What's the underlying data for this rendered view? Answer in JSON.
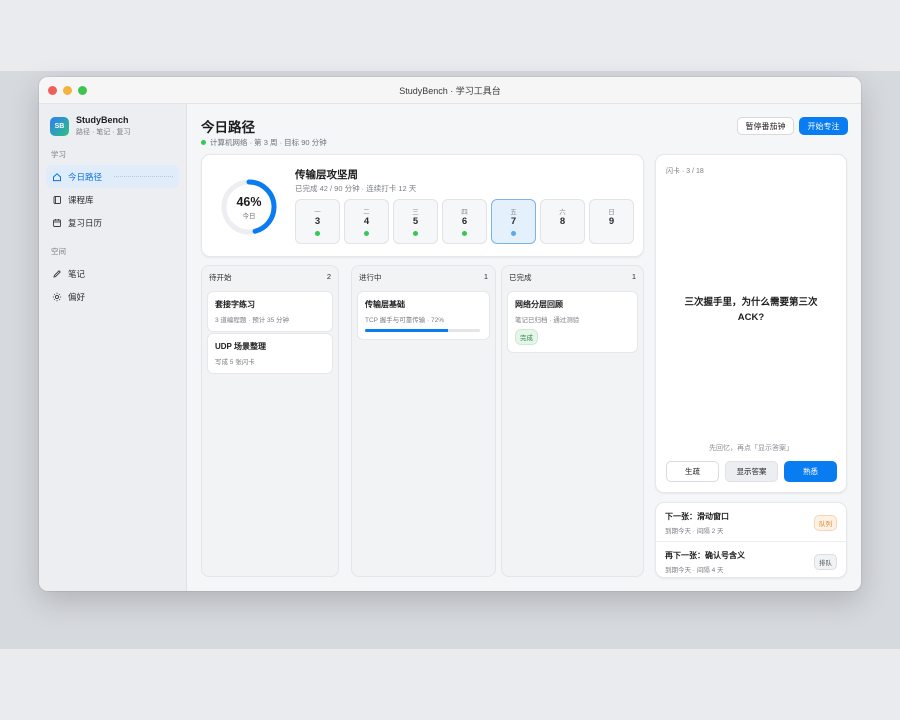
{
  "window": {
    "title": "StudyBench · 学习工具台"
  },
  "sidebar": {
    "brand": {
      "logo": "SB",
      "name": "StudyBench",
      "subtitle": "路径 · 笔记 · 复习"
    },
    "sections": [
      {
        "label": "学习",
        "items": [
          {
            "label": "今日路径",
            "icon": "home-icon",
            "active": true
          },
          {
            "label": "课程库",
            "icon": "book-icon"
          },
          {
            "label": "复习日历",
            "icon": "calendar-icon"
          }
        ]
      },
      {
        "label": "空间",
        "items": [
          {
            "label": "笔记",
            "icon": "pencil-icon"
          },
          {
            "label": "偏好",
            "icon": "sun-icon"
          }
        ]
      }
    ]
  },
  "header": {
    "title": "今日路径",
    "subtitle": "计算机网络 · 第 3 周 · 目标 90 分钟",
    "pause_button": "暂停番茄钟",
    "focus_button": "开始专注"
  },
  "week": {
    "progress_percent": 46,
    "progress_text": "46%",
    "progress_label": "今日",
    "title": "传输层攻坚周",
    "subtitle": "已完成 42 / 90 分钟 · 连续打卡 12 天",
    "days": [
      {
        "label": "一",
        "num": "3",
        "status": "done"
      },
      {
        "label": "二",
        "num": "4",
        "status": "done"
      },
      {
        "label": "三",
        "num": "5",
        "status": "done"
      },
      {
        "label": "四",
        "num": "6",
        "status": "done"
      },
      {
        "label": "五",
        "num": "7",
        "status": "today"
      },
      {
        "label": "六",
        "num": "8",
        "status": "none"
      },
      {
        "label": "日",
        "num": "9",
        "status": "none"
      }
    ]
  },
  "board": {
    "todo": {
      "title": "待开始",
      "count": "2",
      "tasks": [
        {
          "title": "套接字练习",
          "meta": "3 道编程题 · 预计 35 分钟"
        },
        {
          "title": "UDP 场景整理",
          "meta": "写成 5 张闪卡"
        }
      ]
    },
    "doing": {
      "title": "进行中",
      "count": "1",
      "tasks": [
        {
          "title": "传输层基础",
          "meta": "TCP 握手与可靠传输 · 72%",
          "progress": 0.72
        }
      ]
    },
    "done": {
      "title": "已完成",
      "count": "1",
      "tasks": [
        {
          "title": "网络分层回顾",
          "meta": "笔记已归档 · 通过测验",
          "badge": "完成"
        }
      ]
    }
  },
  "flashcard": {
    "header": "闪卡 · 3 / 18",
    "question": "三次握手里，为什么需要第三次 ACK?",
    "hint": "先回忆，再点「显示答案」",
    "buttons": {
      "hard": "生疏",
      "show": "显示答案",
      "easy": "熟悉"
    }
  },
  "queue": [
    {
      "title": "下一张：滑动窗口",
      "meta": "到期今天 · 间隔 2 天",
      "badge": "队列"
    },
    {
      "title": "再下一张：确认号含义",
      "meta": "到期今天 · 间隔 4 天",
      "badge": "排队"
    }
  ],
  "colors": {
    "accent": "#0a7cf2",
    "done": "#34c759",
    "today": "#5aa9ee",
    "warn": "#e0832a"
  }
}
